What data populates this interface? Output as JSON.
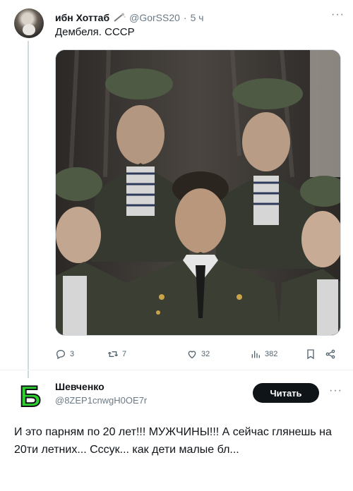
{
  "post1": {
    "author_name": "ибн Хоттаб",
    "author_handle": "@GorSS20",
    "time": "5 ч",
    "text": "Дембеля. СССР",
    "more_label": "···"
  },
  "actions": {
    "replies": "3",
    "reposts": "7",
    "likes": "32",
    "views": "382"
  },
  "post2": {
    "author_name": "Шевченко",
    "author_handle": "@8ZEP1cnwgH0OE7r",
    "follow_label": "Читать",
    "more_label": "···",
    "avatar_letter": "Б",
    "text": "И это парням по 20 лет!!! МУЖЧИНЫ!!! А сейчас глянешь на 20ти летних... Сссук... как дети малые бл..."
  },
  "colors": {
    "accent": "#0f1419",
    "secondary_text": "#6b7a87",
    "avatar2_green": "#2fd12f"
  },
  "icons": [
    "wand-icon",
    "reply-icon",
    "repost-icon",
    "like-icon",
    "views-icon",
    "bookmark-icon",
    "share-icon"
  ]
}
